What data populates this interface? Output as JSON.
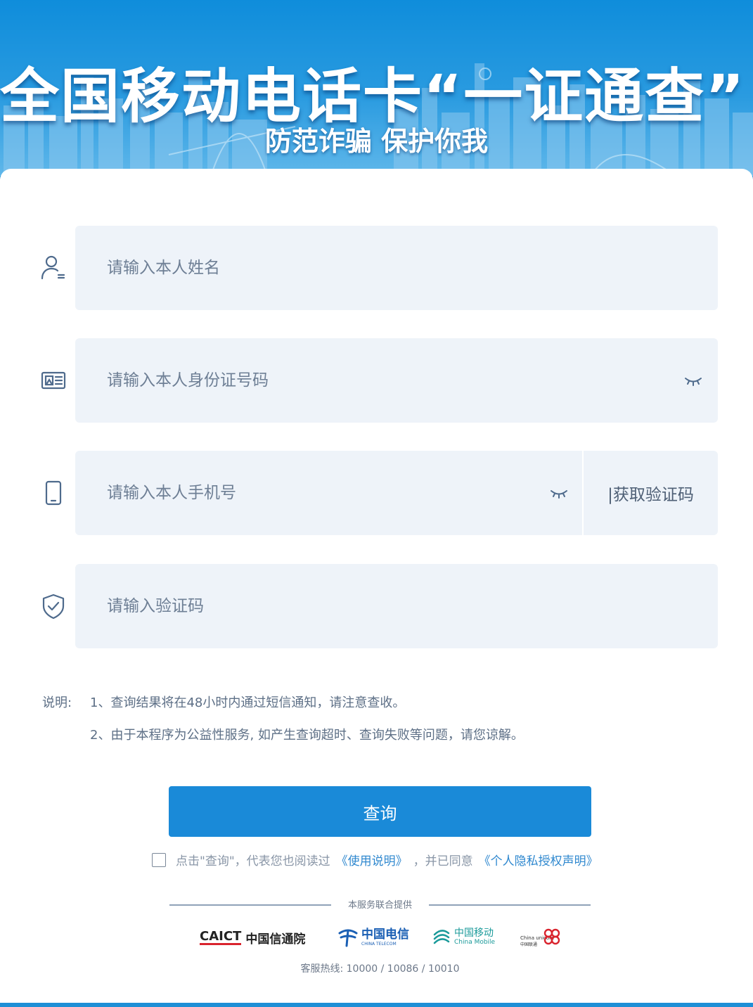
{
  "banner": {
    "title": "全国移动电话卡“一证通查”",
    "subtitle": "防范诈骗 保护你我"
  },
  "form": {
    "name_placeholder": "请输入本人姓名",
    "id_placeholder": "请输入本人身份证号码",
    "phone_placeholder": "请输入本人手机号",
    "sms_button": "|获取验证码",
    "code_placeholder": "请输入验证码"
  },
  "notes": {
    "label": "说明:",
    "line1": "1、查询结果将在48小时内通过短信通知，请注意查收。",
    "line2": "2、由于本程序为公益性服务, 如产生查询超时、查询失败等问题，请您谅解。"
  },
  "query_button": "查询",
  "agreement": {
    "text_before": "点击\"查询\"，代表您也阅读过",
    "link1": "《使用说明》",
    "text_middle": "，并已同意",
    "link2": "《个人隐私授权声明》"
  },
  "footer": {
    "provided_by": "本服务联合提供",
    "logos": {
      "caict_en": "CAICT",
      "caict_cn": "中国信通院",
      "telecom_cn": "中国电信",
      "telecom_en": "CHINA TELECOM",
      "mobile_cn": "中国移动",
      "mobile_en": "China Mobile",
      "unicom_en": "China unicom",
      "unicom_cn": "中国联通"
    },
    "hotline": "客服热线: 10000 / 10086 / 10010"
  },
  "colors": {
    "primary": "#1a8ad8",
    "field_bg": "#eef3f9",
    "icon": "#4e6a8c",
    "link": "#2f88cf"
  }
}
